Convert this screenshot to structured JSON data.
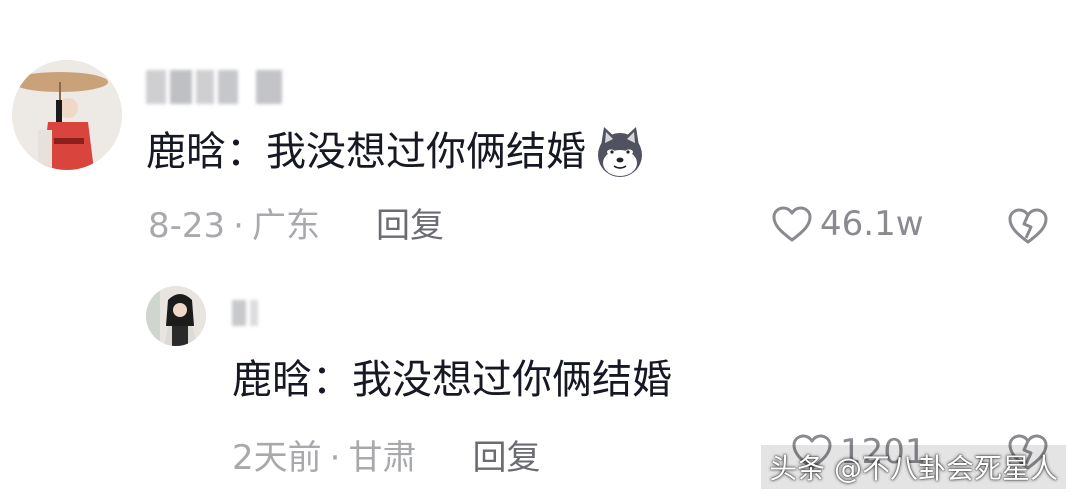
{
  "comment": {
    "author_name": "",
    "text": "鹿晗：我没想过你俩结婚",
    "emoji": "dog-emoji",
    "date": "8-23",
    "separator": "·",
    "location": "广东",
    "reply_label": "回复",
    "like_count": "46.1w"
  },
  "reply": {
    "author_name": "",
    "text": "鹿晗：我没想过你俩结婚",
    "date": "2天前",
    "separator": "·",
    "location": "甘肃",
    "reply_label": "回复",
    "like_count": "1201"
  },
  "watermark": {
    "text": "头条 @不八卦会死星人"
  },
  "colors": {
    "text": "#161823",
    "meta": "#a8a9ad",
    "reply_link": "#6b6c72",
    "icon": "#8a8b90"
  },
  "icons": {
    "like": "heart-outline-icon",
    "dislike": "broken-heart-icon"
  }
}
